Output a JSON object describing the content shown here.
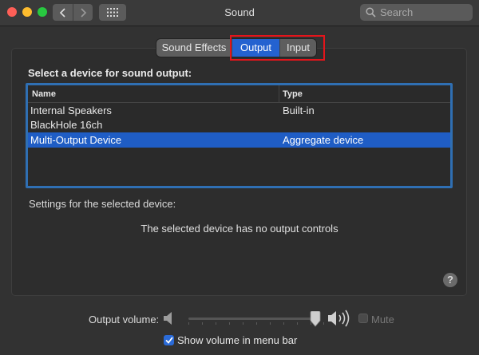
{
  "window": {
    "title": "Sound"
  },
  "search": {
    "placeholder": "Search"
  },
  "tabs": [
    {
      "label": "Sound Effects",
      "active": false
    },
    {
      "label": "Output",
      "active": true
    },
    {
      "label": "Input",
      "active": false
    }
  ],
  "output": {
    "heading": "Select a device for sound output:",
    "columns": [
      "Name",
      "Type"
    ],
    "devices": [
      {
        "name": "Internal Speakers",
        "type": "Built-in",
        "selected": false
      },
      {
        "name": "BlackHole 16ch",
        "type": "",
        "selected": false
      },
      {
        "name": "Multi-Output Device",
        "type": "Aggregate device",
        "selected": true
      }
    ],
    "settings_label": "Settings for the selected device:",
    "no_controls_message": "The selected device has no output controls",
    "help_label": "?"
  },
  "volume": {
    "label": "Output volume:",
    "level": 0.95,
    "mute_label": "Mute",
    "mute_checked": false,
    "mute_enabled": false,
    "show_in_menu_bar_label": "Show volume in menu bar",
    "show_in_menu_bar_checked": true
  },
  "colors": {
    "accent": "#2462d0",
    "selection": "#1f5dc5",
    "highlight_box": "#e3151b",
    "window_bg": "#323232"
  },
  "icons": {
    "back": "chevron-left-icon",
    "forward": "chevron-right-icon",
    "show_all": "grid-icon",
    "search": "search-icon",
    "volume_low": "speaker-low-icon",
    "volume_high": "speaker-high-icon"
  }
}
